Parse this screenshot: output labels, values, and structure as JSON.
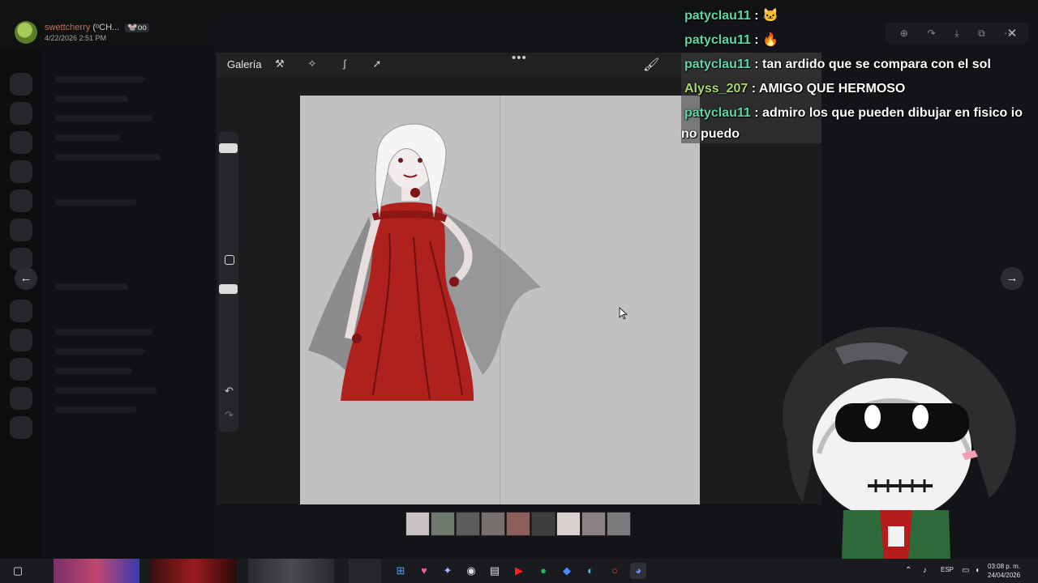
{
  "viewer": {
    "username": "swettcherry",
    "username_tag": "(ᵒCH...",
    "badge": "🐭oo",
    "date": "4/22/2026 2:51 PM"
  },
  "media_toolbar": {
    "icons": [
      "zoom-icon",
      "forward-icon",
      "download-icon",
      "open-external-icon",
      "more-icon"
    ],
    "close_icon": "close-icon"
  },
  "procreate": {
    "gallery_label": "Galería",
    "tools": [
      "wrench-icon",
      "adjust-icon",
      "selection-icon",
      "transform-icon"
    ],
    "more_label": "•••",
    "brush_icon": "brush-icon"
  },
  "navigation": {
    "prev_icon": "arrow-left-icon",
    "next_icon": "arrow-right-icon"
  },
  "chat": [
    {
      "user": "patyclau11",
      "color": "#5fd7a5",
      "separator": " : ",
      "text": "🐱"
    },
    {
      "user": "patyclau11",
      "color": "#5fd7a5",
      "separator": " : ",
      "text": "🔥"
    },
    {
      "user": "patyclau11",
      "color": "#5fd7a5",
      "separator": " : ",
      "text": "tan ardido que se compara con el sol"
    },
    {
      "user": "Alyss_207",
      "color": "#a6d96a",
      "separator": " : ",
      "text": "AMIGO QUE HERMOSO"
    },
    {
      "user": "patyclau11",
      "color": "#5fd7a5",
      "separator": " : ",
      "text": "admiro los que pueden dibujar en fisico io no puedo"
    }
  ],
  "thumbnails": {
    "count": 9,
    "active_index": 6
  },
  "taskbar": {
    "language": "ESP",
    "time": "03:08 p. m.",
    "date": "24/04/2026"
  }
}
